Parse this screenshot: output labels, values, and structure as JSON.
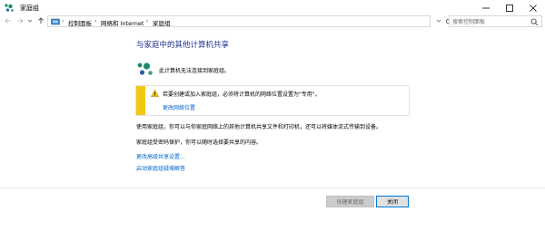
{
  "window": {
    "title": "家庭组",
    "icon": "homegroup-icon"
  },
  "titlebar_buttons": {
    "minimize": "minimize-icon",
    "maximize": "maximize-icon",
    "close": "close-icon"
  },
  "address": {
    "breadcrumbs": [
      "控制面板",
      "网络和 Internet",
      "家庭组"
    ],
    "separator": "›"
  },
  "search": {
    "placeholder": "搜索控制面板"
  },
  "main": {
    "heading": "与家庭中的其他计算机共享",
    "status": "此计算机无法连接到家庭组。",
    "warning": {
      "text": "若要创建或加入家庭组，必须将计算机的网络位置设置为\"专用\"。",
      "link": "更改网络位置"
    },
    "description": "使用家庭组，你可以与你家庭网络上的其他计算机共享文件和打印机，还可以将媒体流式传输到设备。",
    "password_note": "家庭组受密码保护，你可以随时选择要共享的内容。",
    "links": [
      "更改高级共享设置...",
      "启动家庭组疑难解答"
    ]
  },
  "buttons": {
    "create": "创建家庭组",
    "close": "关闭"
  },
  "colors": {
    "heading": "#1e3287",
    "link": "#0066cc",
    "warning_stripe": "#f2c811",
    "focus_border": "#0078d7"
  }
}
